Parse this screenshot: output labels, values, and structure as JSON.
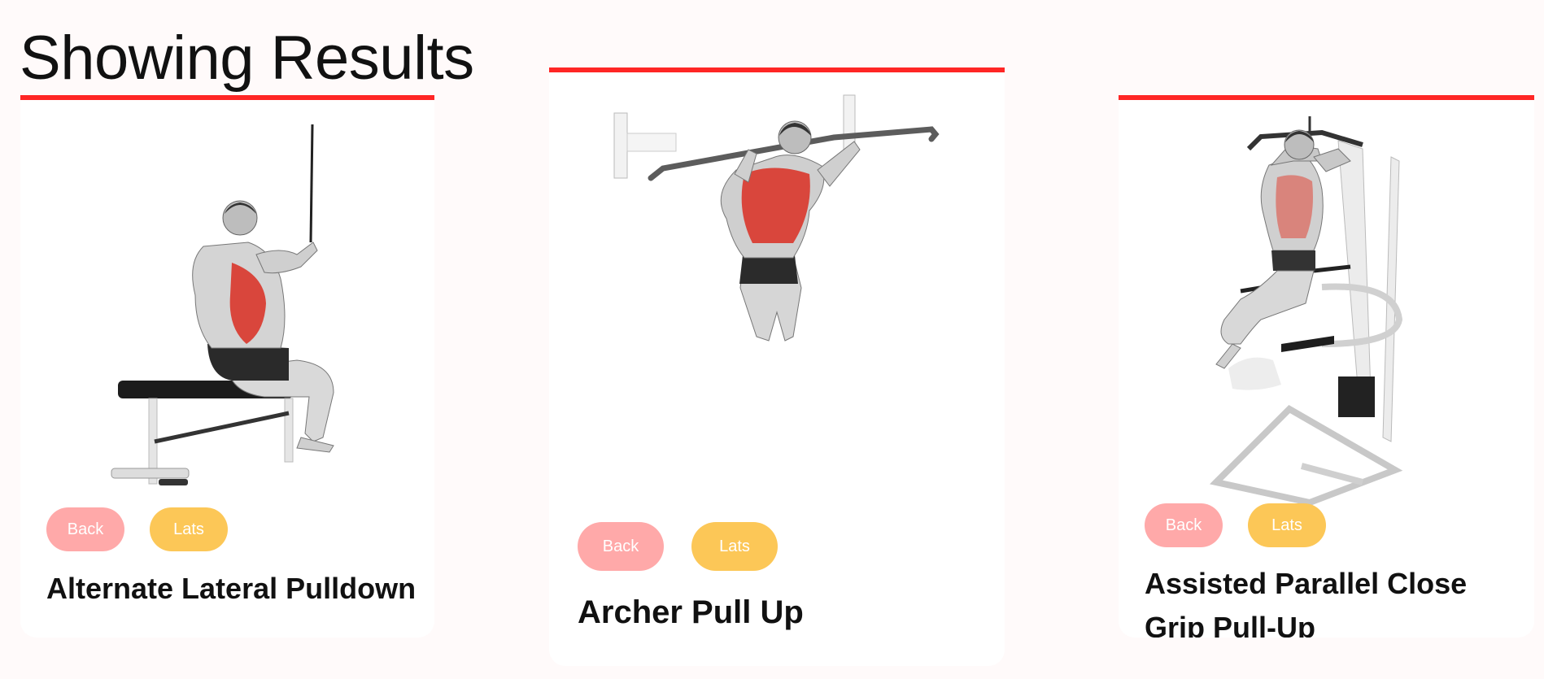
{
  "heading": "Showing Results",
  "colors": {
    "accent": "#ff2625",
    "body_part_tag": "#ffa9a9",
    "target_tag": "#fcc757"
  },
  "exercises": [
    {
      "name": "Alternate Lateral Pulldown",
      "body_part": "Back",
      "target": "Lats",
      "illustration": "lat-pulldown-illustration"
    },
    {
      "name": "Archer Pull Up",
      "body_part": "Back",
      "target": "Lats",
      "illustration": "pull-up-illustration"
    },
    {
      "name": "Assisted Parallel Close Grip Pull-Up",
      "body_part": "Back",
      "target": "Lats",
      "illustration": "assisted-pull-up-illustration"
    }
  ]
}
